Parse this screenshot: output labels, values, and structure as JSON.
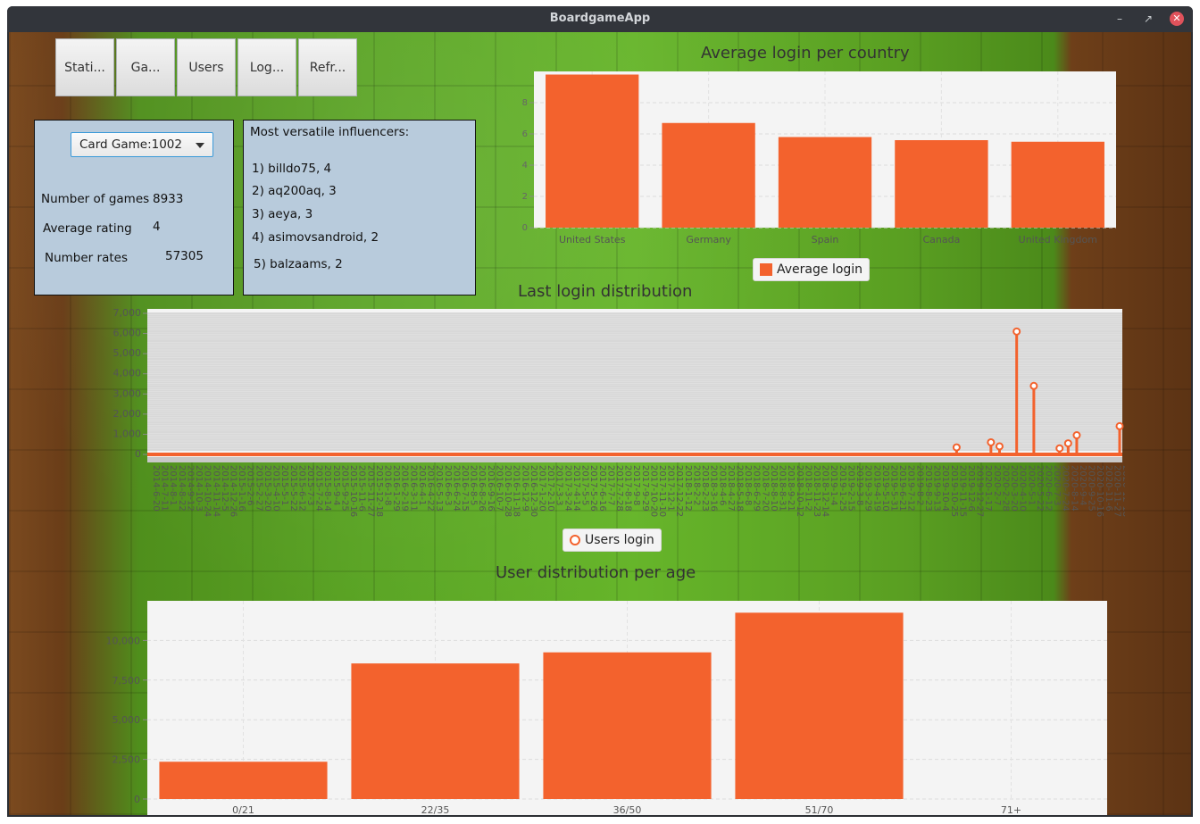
{
  "window": {
    "title": "BoardgameApp"
  },
  "nav": {
    "buttons": [
      "Stati...",
      "Ga...",
      "Users",
      "Log...",
      "Refr..."
    ]
  },
  "stats_panel": {
    "game_select": "Card Game:1002",
    "rows": [
      {
        "label": "Number of games",
        "value": "8933"
      },
      {
        "label": "Average rating",
        "value": "4"
      },
      {
        "label": "Number rates",
        "value": "57305"
      }
    ]
  },
  "influencers_panel": {
    "heading": "Most versatile influencers:",
    "items": [
      "1)  billdo75, 4",
      "2)  aq200aq, 3",
      "3)  aeya, 3",
      "4)  asimovsandroid, 2",
      "5)  balzaams, 2"
    ]
  },
  "colors": {
    "series": "#f3622d",
    "panel": "#b8cbdc",
    "plot_bg": "#f4f4f4"
  },
  "chart_data": [
    {
      "type": "bar",
      "title": "Average login per country",
      "categories": [
        "United States",
        "Germany",
        "Spain",
        "Canada",
        "United Kingdom"
      ],
      "series": [
        {
          "name": "Average login",
          "values": [
            9.8,
            6.7,
            5.8,
            5.6,
            5.5
          ]
        }
      ],
      "ylim": [
        0,
        10
      ],
      "yticks": [
        "0",
        "2",
        "4",
        "6",
        "8"
      ],
      "grid": true,
      "legend": "bottom"
    },
    {
      "type": "line",
      "title": "Last login distribution",
      "yticks": [
        "0",
        "1,000",
        "2,000",
        "3,000",
        "4,000",
        "5,000",
        "6,000",
        "7,000"
      ],
      "ylim": [
        0,
        7000
      ],
      "x": [
        "2014-6-20",
        "2014-7-11",
        "2014-8-1",
        "2014-8-22",
        "2014-9-12",
        "2014-10-3",
        "2014-10-24",
        "2014-11-14",
        "2014-12-5",
        "2014-12-26",
        "2015-1-16",
        "2015-2-6",
        "2015-2-27",
        "2015-3-20",
        "2015-4-10",
        "2015-5-1",
        "2015-5-22",
        "2015-6-12",
        "2015-7-3",
        "2015-7-24",
        "2015-8-14",
        "2015-9-4",
        "2015-9-25",
        "2015-10-16",
        "2015-11-6",
        "2015-11-27",
        "2015-12-18",
        "2016-1-8",
        "2016-1-29",
        "2016-2-19",
        "2016-3-11",
        "2016-4-1",
        "2016-4-22",
        "2016-5-13",
        "2016-6-3",
        "2016-6-24",
        "2016-7-15",
        "2016-8-5",
        "2016-8-26",
        "2016-9-16",
        "2016-10-7",
        "2016-10-28",
        "2016-11-18",
        "2016-12-9",
        "2016-12-30",
        "2017-1-20",
        "2017-2-10",
        "2017-3-3",
        "2017-3-24",
        "2017-4-14",
        "2017-5-5",
        "2017-5-26",
        "2017-6-16",
        "2017-7-7",
        "2017-7-28",
        "2017-8-18",
        "2017-9-8",
        "2017-9-29",
        "2017-10-20",
        "2017-11-10",
        "2017-12-1",
        "2017-12-22",
        "2018-1-12",
        "2018-2-2",
        "2018-2-23",
        "2018-3-16",
        "2018-4-6",
        "2018-4-27",
        "2018-5-18",
        "2018-6-8",
        "2018-6-29",
        "2018-7-20",
        "2018-8-10",
        "2018-8-31",
        "2018-9-21",
        "2018-10-12",
        "2018-11-2",
        "2018-11-23",
        "2018-12-14",
        "2019-1-4",
        "2019-1-25",
        "2019-2-15",
        "2019-3-8",
        "2019-3-29",
        "2019-4-19",
        "2019-5-10",
        "2019-5-31",
        "2019-6-21",
        "2019-7-12",
        "2019-8-2",
        "2019-8-23",
        "2019-9-13",
        "2019-10-4",
        "2019-10-25",
        "2019-11-15",
        "2019-12-6",
        "2019-12-27",
        "2020-1-17",
        "2020-2-7",
        "2020-2-28",
        "2020-3-20",
        "2020-4-10",
        "2020-5-1",
        "2020-5-22",
        "2020-6-12",
        "2020-7-3",
        "2020-7-24",
        "2020-8-14",
        "2020-9-4",
        "2020-9-25",
        "2020-10-16",
        "2020-11-6",
        "2020-11-27",
        "2020-12-18"
      ],
      "series": [
        {
          "name": "Users login",
          "peaks": [
            {
              "x": "2019-11-15",
              "y": 350
            },
            {
              "x": "2020-2-7",
              "y": 600
            },
            {
              "x": "2020-2-28",
              "y": 400
            },
            {
              "x": "2020-4-10",
              "y": 6100
            },
            {
              "x": "2020-5-22",
              "y": 3400
            },
            {
              "x": "2020-7-24",
              "y": 300
            },
            {
              "x": "2020-8-14",
              "y": 550
            },
            {
              "x": "2020-9-4",
              "y": 950
            },
            {
              "x": "2020-12-18",
              "y": 1400
            }
          ]
        }
      ],
      "legend": "bottom"
    },
    {
      "type": "bar",
      "title": "User distribution per age",
      "categories": [
        "0/21",
        "22/35",
        "36/50",
        "51/70",
        "71+"
      ],
      "series": [
        {
          "name": "",
          "values": [
            2350,
            8550,
            9250,
            11750,
            0
          ]
        }
      ],
      "ylim": [
        0,
        12500
      ],
      "yticks": [
        "0",
        "2,500",
        "5,000",
        "7,500",
        "10,000"
      ],
      "grid": true
    }
  ]
}
